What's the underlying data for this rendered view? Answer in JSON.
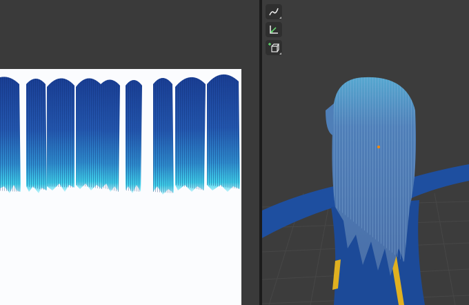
{
  "uv_editor": {
    "background": "#3a3a3a",
    "canvas_background": "#fbfcfe",
    "hair_strips_count": 9
  },
  "viewport": {
    "background": "#3c3c3c",
    "grid_color": "#474747",
    "body_color": "#1e4fa0",
    "hair_color": "#5f86b8",
    "accent_color": "#e0b020",
    "origin_color": "#ff8a00"
  },
  "toolbar": {
    "tools": [
      {
        "icon": "annotate-icon"
      },
      {
        "icon": "measure-icon"
      },
      {
        "icon": "add-cube-icon"
      }
    ]
  }
}
